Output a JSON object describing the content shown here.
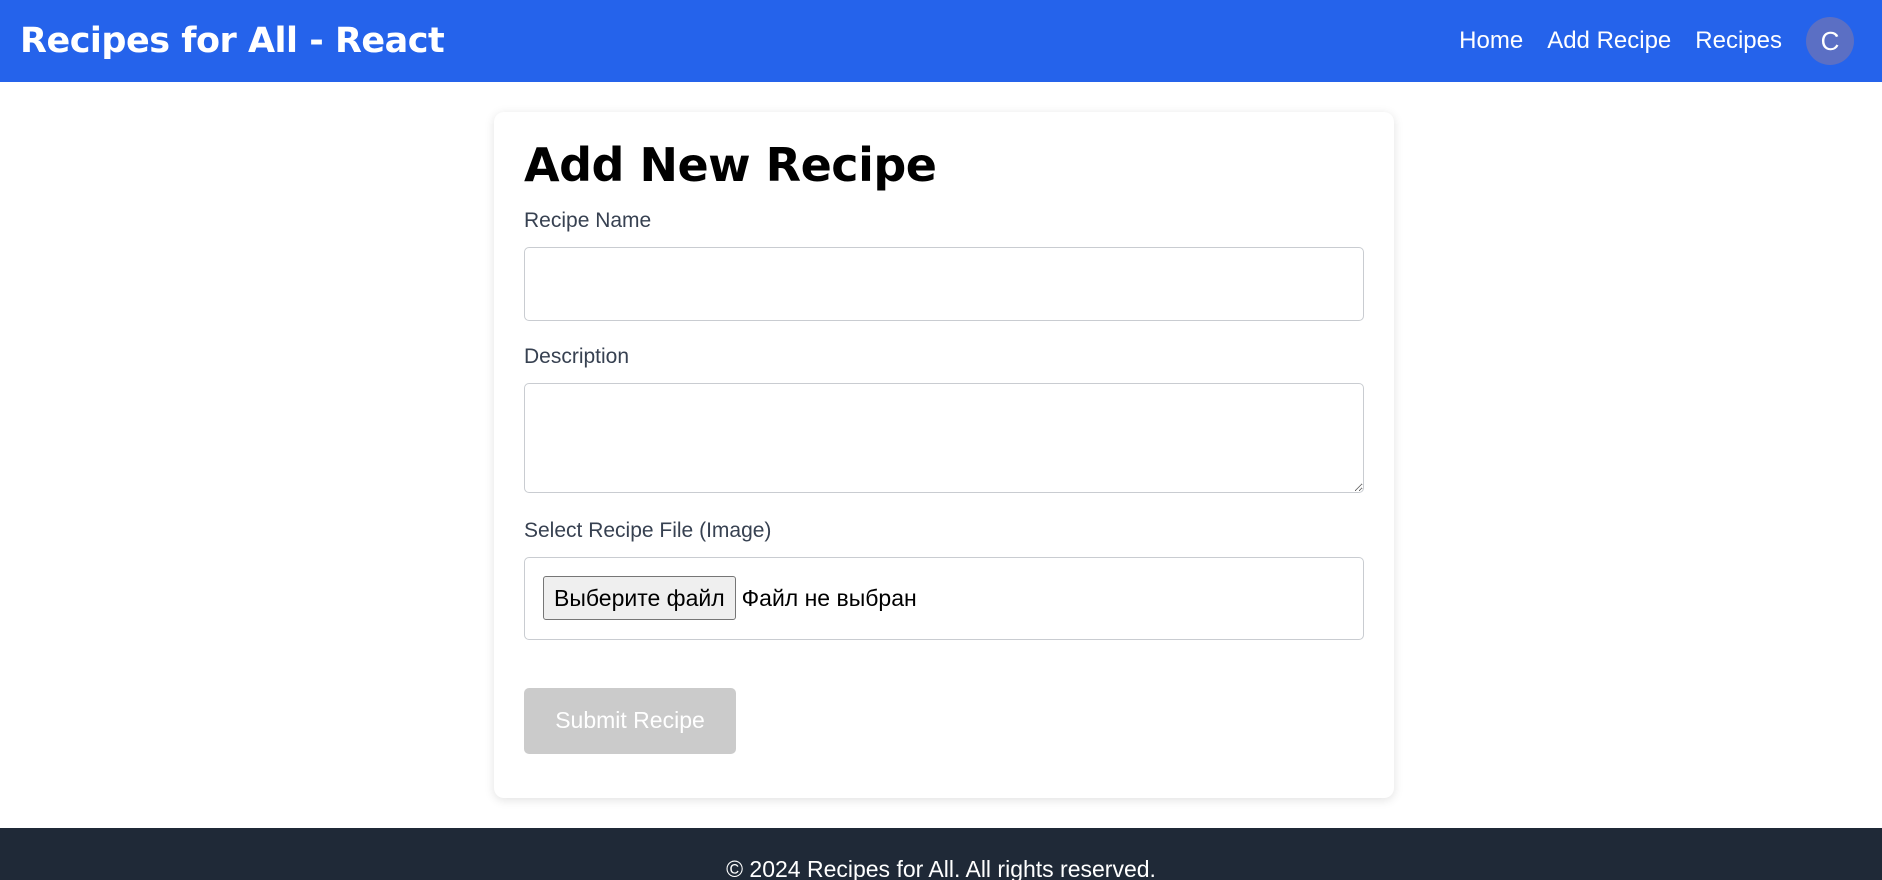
{
  "navbar": {
    "brand": "Recipes for All - React",
    "links": [
      "Home",
      "Add Recipe",
      "Recipes"
    ],
    "avatar_initial": "C",
    "background_color": "#2563eb"
  },
  "form": {
    "title": "Add New Recipe",
    "recipe_name_label": "Recipe Name",
    "recipe_name_value": "",
    "description_label": "Description",
    "description_value": "",
    "file_label": "Select Recipe File (Image)",
    "file_button_label": "Выберите файл",
    "file_status": "Файл не выбран",
    "submit_label": "Submit Recipe",
    "submit_disabled": true
  },
  "footer": {
    "text": "© 2024 Recipes for All. All rights reserved.",
    "background_color": "#1f2937"
  }
}
